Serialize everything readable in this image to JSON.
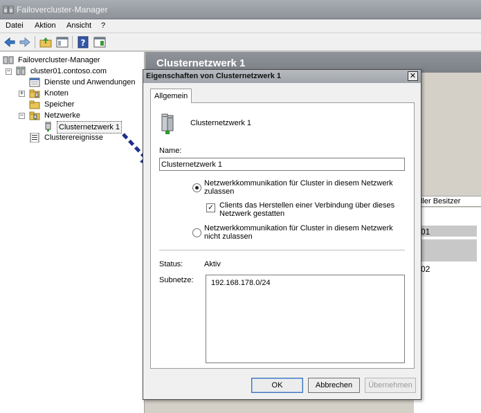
{
  "window": {
    "title": "Failovercluster-Manager"
  },
  "menu": {
    "items": [
      "Datei",
      "Aktion",
      "Ansicht",
      "?"
    ]
  },
  "toolbar": {
    "buttons": [
      "back-icon",
      "forward-icon",
      "up-folder-icon",
      "show-pane-icon",
      "help-icon",
      "properties-pane-icon"
    ]
  },
  "tree": {
    "root": "Failovercluster-Manager",
    "cluster": "cluster01.contoso.com",
    "items": {
      "services": "Dienste und Anwendungen",
      "nodes": "Knoten",
      "storage": "Speicher",
      "networks": "Netzwerke",
      "network1": "Clusternetzwerk 1",
      "events": "Clusterereignisse"
    },
    "expanders": {
      "collapse": "−",
      "expand": "+"
    }
  },
  "right_pane": {
    "header": "Clusternetzwerk 1",
    "column_header_fragment": "ller Besitzer",
    "row_fragments": [
      "01",
      "02"
    ]
  },
  "dialog": {
    "title": "Eigenschaften von Clusternetzwerk 1",
    "close_glyph": "✕",
    "tab_label": "Allgemein",
    "network_label": "Clusternetzwerk 1",
    "name_label": "Name:",
    "name_value": "Clusternetzwerk 1",
    "radio_allow_line1": "Netzwerkkommunikation für Cluster in diesem Netzwerk",
    "radio_allow_line2": "zulassen",
    "radio_allow_selected": true,
    "checkbox_clients_line1": "Clients das Herstellen einer Verbindung über dieses",
    "checkbox_clients_line2": "Netzwerk gestatten",
    "checkbox_clients_checked": true,
    "checkbox_mark": "✓",
    "radio_deny_line1": "Netzwerkkommunikation für Cluster in diesem Netzwerk",
    "radio_deny_line2": "nicht zulassen",
    "status_label": "Status:",
    "status_value": "Aktiv",
    "subnets_label": "Subnetze:",
    "subnets": [
      "192.168.178.0/24"
    ],
    "buttons": {
      "ok": "OK",
      "cancel": "Abbrechen",
      "apply": "Übernehmen"
    }
  },
  "colors": {
    "titlebar": "#8e9399",
    "selection_arrow": "#1f2f8a",
    "dialog_bg": "#f0f0f0"
  }
}
